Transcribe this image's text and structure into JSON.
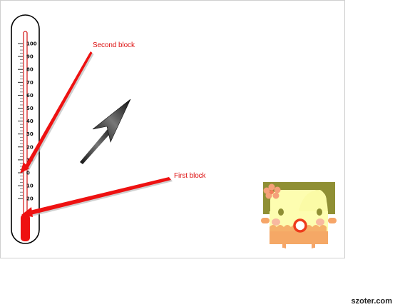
{
  "thermometer": {
    "scale_labels": [
      "100",
      "90",
      "80",
      "70",
      "60",
      "50",
      "40",
      "30",
      "20",
      "10",
      "0",
      "10",
      "20"
    ],
    "scale_max": 100,
    "scale_min": -20,
    "liquid_color": "#ee1111"
  },
  "callouts": {
    "second": "Second block",
    "first": "First block",
    "color": "#ee1111"
  },
  "watermark": "szoter.com",
  "icons": {
    "arrow": "arrow-up-right-icon",
    "character": "cartoon-girl-icon"
  }
}
